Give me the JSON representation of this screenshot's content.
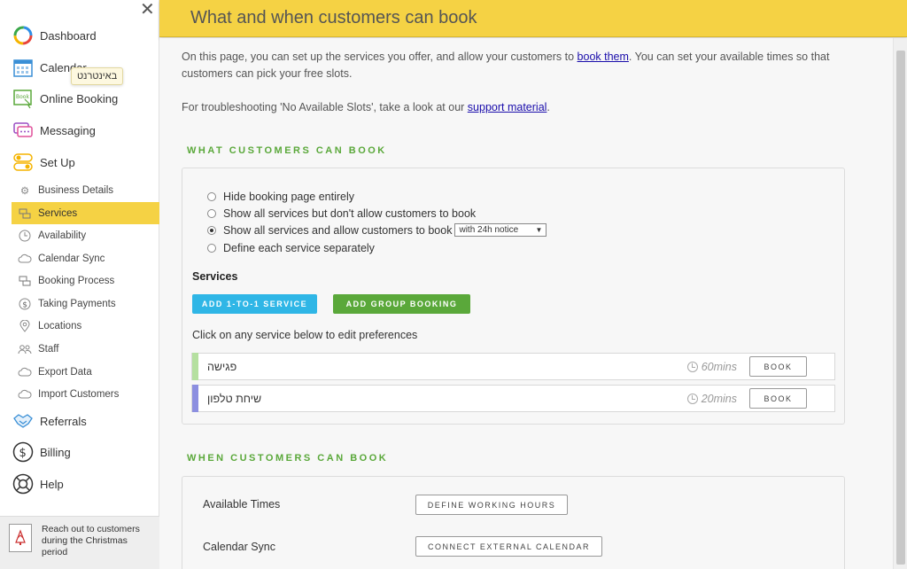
{
  "sidebar": {
    "tooltip": "באינטרנט",
    "main_items": [
      {
        "label": "Dashboard",
        "icon": "dashboard-icon"
      },
      {
        "label": "Calendar",
        "icon": "calendar-icon"
      },
      {
        "label": "Online Booking",
        "icon": "online-booking-icon"
      },
      {
        "label": "Messaging",
        "icon": "messaging-icon"
      },
      {
        "label": "Set Up",
        "icon": "setup-icon"
      }
    ],
    "sub_items": [
      {
        "label": "Business Details",
        "icon": "gear-icon"
      },
      {
        "label": "Services",
        "icon": "services-icon"
      },
      {
        "label": "Availability",
        "icon": "clock-icon"
      },
      {
        "label": "Calendar Sync",
        "icon": "cloud-icon"
      },
      {
        "label": "Booking Process",
        "icon": "booking-process-icon"
      },
      {
        "label": "Taking Payments",
        "icon": "dollar-icon"
      },
      {
        "label": "Locations",
        "icon": "map-pin-icon"
      },
      {
        "label": "Staff",
        "icon": "staff-icon"
      },
      {
        "label": "Export Data",
        "icon": "cloud-export-icon"
      },
      {
        "label": "Import Customers",
        "icon": "cloud-import-icon"
      }
    ],
    "bottom_items": [
      {
        "label": "Referrals",
        "icon": "handshake-icon"
      },
      {
        "label": "Billing",
        "icon": "dollar-circle-icon"
      },
      {
        "label": "Help",
        "icon": "lifebuoy-icon"
      }
    ],
    "promo": "Reach out to customers during the Christmas period"
  },
  "header": {
    "title": "What and when customers can book"
  },
  "intro": {
    "p1_before": "On this page, you can set up the services you offer, and allow your customers to ",
    "p1_link": "book them",
    "p1_after": ". You can set your available times so that customers can pick your free slots.",
    "p2_before": "For troubleshooting 'No Available Slots', take a look at our ",
    "p2_link": "support material",
    "p2_after": "."
  },
  "what_section": {
    "title": "WHAT CUSTOMERS CAN BOOK",
    "options": [
      "Hide booking page entirely",
      "Show all services but don't allow customers to book",
      "Show all services and allow customers to book",
      "Define each service separately"
    ],
    "selected_index": 2,
    "notice_select": "with 24h notice",
    "services_heading": "Services",
    "add_one_to_one": "ADD 1-TO-1 SERVICE",
    "add_group": "ADD GROUP BOOKING",
    "click_hint": "Click on any service below to edit preferences",
    "services": [
      {
        "name": "פגישה",
        "duration": "60mins",
        "color": "#b5e0a0",
        "book": "BOOK"
      },
      {
        "name": "שיחת טלפון",
        "duration": "20mins",
        "color": "#8c8fe0",
        "book": "BOOK"
      }
    ]
  },
  "when_section": {
    "title": "WHEN CUSTOMERS CAN BOOK",
    "available_times_label": "Available Times",
    "define_hours_button": "DEFINE WORKING HOURS",
    "calendar_sync_label": "Calendar Sync",
    "connect_calendar_button": "CONNECT EXTERNAL CALENDAR"
  },
  "colors": {
    "accent_yellow": "#f5d244",
    "green": "#5aa83a",
    "blue_button": "#2fb6e6",
    "green_button": "#5aa83a"
  }
}
